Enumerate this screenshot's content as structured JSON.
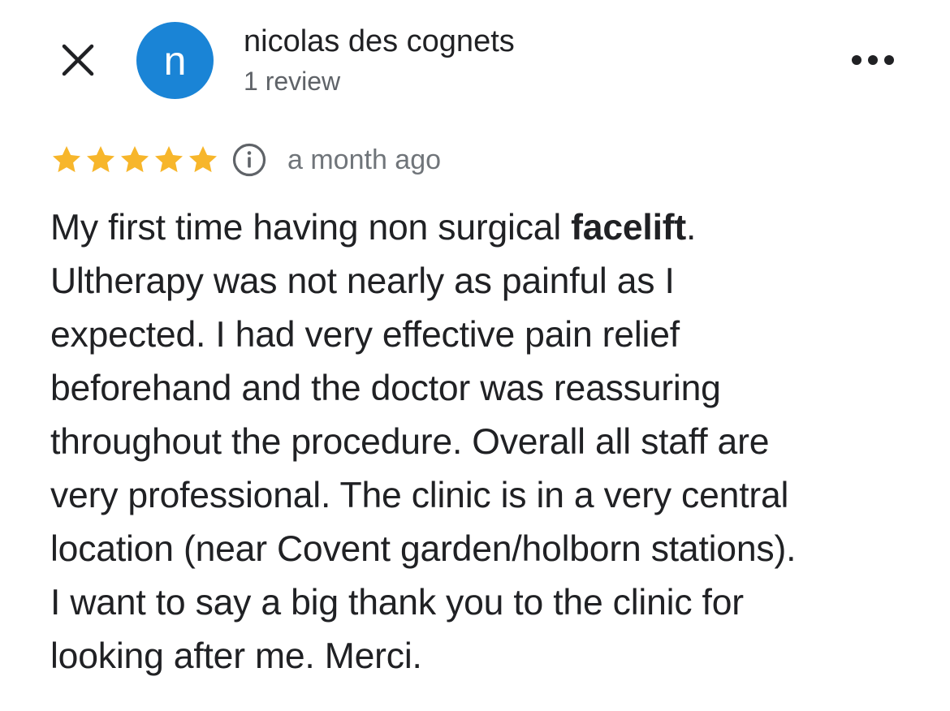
{
  "header": {
    "author_name": "nicolas des cognets",
    "review_count": "1 review",
    "avatar_initial": "n",
    "avatar_color": "#1a84d6"
  },
  "icons": {
    "close": "close-icon",
    "more": "more-horizontal-icon",
    "info": "info-icon",
    "star": "star-icon"
  },
  "review": {
    "rating": 5,
    "max_rating": 5,
    "star_color": "#f7b62b",
    "time_ago": "a month ago",
    "lines": [
      {
        "before": "My first time having non surgical ",
        "bold": "facelift",
        "after": "."
      },
      {
        "text": "Ultherapy was not nearly as painful as I"
      },
      {
        "text": "expected. I had very effective pain relief"
      },
      {
        "text": "beforehand and the doctor was reassuring"
      },
      {
        "text": "throughout the procedure. Overall all staff are"
      },
      {
        "text": "very professional. The clinic is in a very central"
      },
      {
        "text": "location (near Covent garden/holborn stations)."
      },
      {
        "text": "I want to say a big thank you to the clinic for"
      },
      {
        "text": "looking after me. Merci."
      }
    ]
  }
}
